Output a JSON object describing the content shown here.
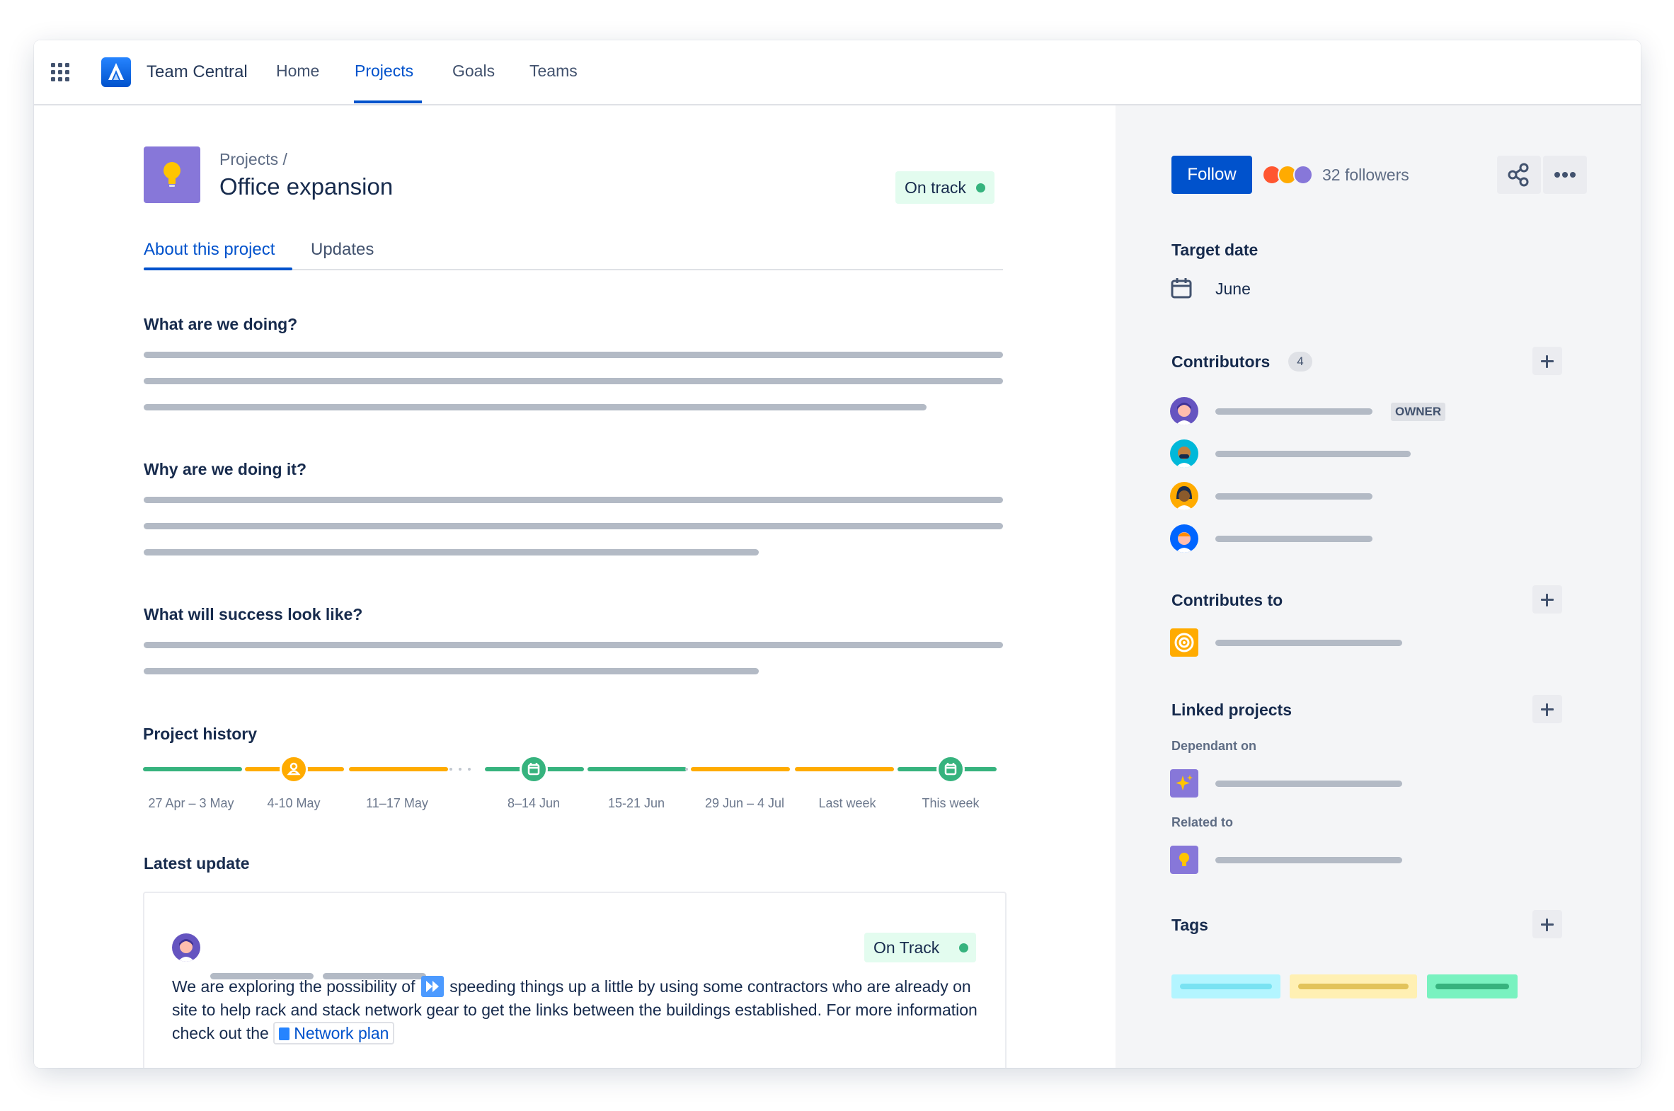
{
  "nav": {
    "brand": "Team Central",
    "items": [
      "Home",
      "Projects",
      "Goals",
      "Teams"
    ],
    "active": "Projects"
  },
  "project": {
    "breadcrumb": "Projects  /",
    "title": "Office expansion",
    "status": "On track",
    "status_color": "#36b37e",
    "icon": "lightbulb-icon"
  },
  "tabs": [
    "About this project",
    "Updates"
  ],
  "sections": {
    "doing": "What are we doing?",
    "why": "Why are we doing it?",
    "success": "What will success look like?",
    "history": "Project history",
    "latest": "Latest update"
  },
  "timeline": {
    "labels": [
      "27 Apr – 3 May",
      "4-10 May",
      "11–17 May",
      "8–14 Jun",
      "15-21 Jun",
      "29 Jun – 4 Jul",
      "Last week",
      "This week"
    ],
    "states": [
      "on-track",
      "at-risk",
      "at-risk",
      "on-track",
      "on-track",
      "at-risk",
      "at-risk",
      "on-track"
    ],
    "colors": {
      "on-track": "#36b37e",
      "at-risk": "#ffab00"
    }
  },
  "update": {
    "status": "On Track",
    "text_before": "We are exploring the possibility of",
    "text_middle": "speeding things up a little by using some contractors who are already on site to help rack and stack network gear to get the links between the buildings established. For more information check out the",
    "link": "Network plan"
  },
  "sidebar": {
    "follow": "Follow",
    "followers": "32 followers",
    "target_date_label": "Target date",
    "target_date": "June",
    "contributors_label": "Contributors",
    "contributors_count": "4",
    "owner_badge": "OWNER",
    "contributes_to_label": "Contributes to",
    "linked_label": "Linked projects",
    "dependant_on": "Dependant on",
    "related_to": "Related to",
    "tags_label": "Tags",
    "tag_colors": [
      "#b3f5ff",
      "#fff0b3",
      "#79f2c0"
    ]
  }
}
